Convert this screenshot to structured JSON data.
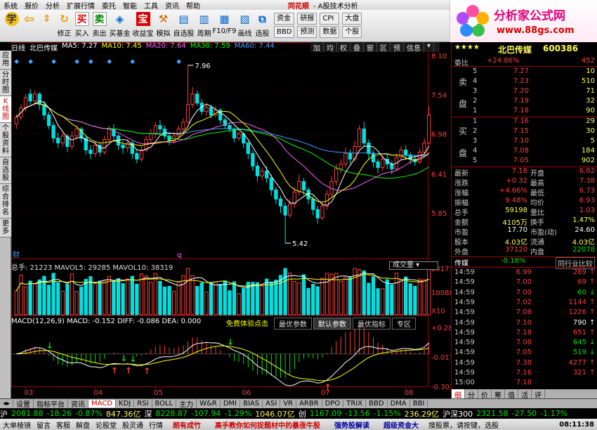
{
  "menu": {
    "items": [
      "系统",
      "报价",
      "分析",
      "扩展行情",
      "委托",
      "智能",
      "工具",
      "资讯",
      "帮助"
    ],
    "brand": "同花顺",
    "app_title": "- A股技术分析"
  },
  "logo": {
    "text1": "分析家公式网",
    "text2": "www.88gs.com"
  },
  "toolbar": {
    "buttons": [
      "",
      "",
      "修正",
      "买入",
      "卖出",
      "买基金",
      "收益宝",
      "模拟",
      "自选股",
      "周期",
      "F10/F9",
      "画线",
      "选股"
    ],
    "right_buttons": [
      "资金",
      "研报",
      "CPI",
      "大盘",
      "BBD",
      "预测",
      "数据",
      "个股"
    ]
  },
  "left_tabs": [
    "应用",
    "分时图",
    "K线图",
    "个股资料",
    "自选股",
    "综合排名",
    "更多"
  ],
  "kline": {
    "period": "日线",
    "name": "北巴传媒",
    "ma5": "MA5: 7.27",
    "ma10": "MA10: 7.45",
    "ma20": "MA20: 7.64",
    "ma30": "MA30: 7.59",
    "ma60": "MA60: 7.44",
    "buttons": [
      "加",
      "均",
      "权",
      "叠",
      "窗",
      "区",
      "预",
      "信息"
    ],
    "high_label": "7.96",
    "low_label": "5.42",
    "cai_label": "财",
    "q_label": "q",
    "price_ticks": [
      "8.10",
      "7.54",
      "6.98",
      "6.41",
      "5.85"
    ],
    "volume_info": "总手: 21223  MAVOL5: 29285  MAVOL10: 38319",
    "volume_select": "成交量",
    "volume_ticks": [
      "20177",
      "10088",
      "X10"
    ],
    "macd_info": "MACD(12,26,9)  MACD: -0.152  DIFF: -0.086  DEA: 0.000",
    "macd_btns": [
      "免费体验点击",
      "最优参数",
      "默认参数",
      "最优指标",
      "专区"
    ],
    "macd_ticks": [
      "+0.287",
      "-0.017",
      "-0.303"
    ],
    "date_ticks": [
      "03",
      "04",
      "05",
      "06",
      "07",
      "08"
    ]
  },
  "chart_data": {
    "type": "candlestick",
    "title": "北巴传媒 日线",
    "ylim": [
      5.3,
      8.15
    ],
    "x_months": [
      "03",
      "04",
      "05",
      "06",
      "07",
      "08"
    ],
    "candles": [
      [
        7.12,
        7.22,
        7.26,
        7.05
      ],
      [
        7.22,
        7.35,
        7.4,
        7.18
      ],
      [
        7.35,
        7.5,
        7.55,
        7.3
      ],
      [
        7.55,
        7.45,
        7.62,
        7.4
      ],
      [
        7.45,
        7.55,
        7.6,
        7.38
      ],
      [
        7.55,
        7.4,
        7.58,
        7.32
      ],
      [
        7.4,
        7.25,
        7.45,
        7.18
      ],
      [
        7.25,
        7.1,
        7.3,
        7.05
      ],
      [
        7.1,
        6.92,
        7.15,
        6.85
      ],
      [
        6.92,
        6.85,
        7.0,
        6.78
      ],
      [
        6.85,
        6.95,
        7.0,
        6.8
      ],
      [
        6.95,
        6.8,
        6.98,
        6.72
      ],
      [
        6.8,
        6.95,
        7.02,
        6.76
      ],
      [
        6.95,
        7.05,
        7.1,
        6.9
      ],
      [
        7.05,
        6.92,
        7.08,
        6.86
      ],
      [
        6.92,
        6.75,
        6.95,
        6.68
      ],
      [
        6.75,
        6.7,
        6.82,
        6.62
      ],
      [
        6.7,
        6.82,
        6.88,
        6.65
      ],
      [
        6.82,
        6.72,
        6.86,
        6.66
      ],
      [
        6.72,
        6.9,
        6.95,
        6.68
      ],
      [
        6.9,
        7.05,
        7.1,
        6.86
      ],
      [
        7.05,
        6.95,
        7.12,
        6.9
      ],
      [
        6.95,
        6.82,
        6.98,
        6.75
      ],
      [
        6.82,
        6.78,
        6.88,
        6.7
      ],
      [
        6.78,
        6.85,
        6.9,
        6.72
      ],
      [
        6.85,
        6.7,
        6.88,
        6.62
      ],
      [
        6.7,
        6.62,
        6.75,
        6.56
      ],
      [
        6.62,
        6.75,
        6.8,
        6.58
      ],
      [
        6.75,
        6.9,
        6.95,
        6.72
      ],
      [
        6.9,
        6.98,
        7.05,
        6.85
      ],
      [
        6.98,
        7.1,
        7.15,
        6.92
      ],
      [
        7.1,
        7.05,
        7.18,
        7.0
      ],
      [
        7.05,
        6.95,
        7.1,
        6.9
      ],
      [
        6.95,
        6.88,
        7.0,
        6.82
      ],
      [
        6.88,
        6.95,
        7.0,
        6.84
      ],
      [
        6.95,
        7.05,
        7.1,
        6.9
      ],
      [
        7.05,
        7.15,
        7.2,
        7.0
      ],
      [
        7.15,
        7.4,
        7.96,
        7.12
      ],
      [
        7.4,
        7.55,
        7.65,
        7.35
      ],
      [
        7.55,
        7.42,
        7.6,
        7.38
      ],
      [
        7.42,
        7.3,
        7.48,
        7.25
      ],
      [
        7.3,
        7.36,
        7.42,
        7.24
      ],
      [
        7.36,
        7.25,
        7.4,
        7.2
      ],
      [
        7.25,
        7.32,
        7.38,
        7.22
      ],
      [
        7.32,
        7.18,
        7.35,
        7.12
      ],
      [
        7.18,
        7.1,
        7.22,
        7.05
      ],
      [
        7.1,
        7.05,
        7.15,
        7.0
      ],
      [
        7.05,
        6.92,
        7.08,
        6.86
      ],
      [
        6.92,
        6.98,
        7.02,
        6.88
      ],
      [
        6.98,
        6.85,
        7.0,
        6.78
      ],
      [
        6.85,
        6.7,
        6.88,
        6.62
      ],
      [
        6.7,
        6.52,
        6.75,
        6.45
      ],
      [
        6.52,
        6.38,
        6.58,
        6.3
      ],
      [
        6.38,
        6.45,
        6.5,
        6.32
      ],
      [
        6.45,
        6.35,
        6.52,
        6.28
      ],
      [
        6.35,
        6.18,
        6.4,
        6.1
      ],
      [
        6.18,
        6.05,
        6.22,
        5.98
      ],
      [
        6.05,
        5.95,
        6.1,
        5.85
      ],
      [
        5.95,
        5.82,
        6.0,
        5.42
      ],
      [
        5.82,
        5.98,
        6.05,
        5.78
      ],
      [
        5.98,
        6.15,
        6.22,
        5.92
      ],
      [
        6.15,
        6.3,
        6.4,
        6.1
      ],
      [
        6.3,
        6.18,
        6.35,
        6.1
      ],
      [
        6.18,
        6.05,
        6.22,
        5.98
      ],
      [
        6.05,
        5.9,
        6.1,
        5.82
      ],
      [
        5.9,
        5.78,
        5.95,
        5.7
      ],
      [
        5.78,
        5.95,
        6.0,
        5.75
      ],
      [
        5.95,
        6.12,
        6.18,
        5.9
      ],
      [
        6.12,
        6.3,
        6.38,
        6.08
      ],
      [
        6.3,
        6.48,
        6.55,
        6.25
      ],
      [
        6.48,
        6.55,
        6.62,
        6.42
      ],
      [
        6.55,
        6.7,
        6.78,
        6.5
      ],
      [
        6.7,
        6.62,
        6.76,
        6.55
      ],
      [
        6.62,
        6.8,
        6.88,
        6.58
      ],
      [
        6.8,
        7.05,
        7.1,
        6.78
      ],
      [
        7.05,
        6.85,
        7.15,
        6.8
      ],
      [
        6.85,
        6.7,
        6.9,
        6.62
      ],
      [
        6.7,
        6.58,
        6.75,
        6.5
      ],
      [
        6.58,
        6.5,
        6.62,
        6.42
      ],
      [
        6.5,
        6.62,
        6.68,
        6.45
      ],
      [
        6.62,
        6.55,
        6.68,
        6.48
      ],
      [
        6.55,
        6.48,
        6.6,
        6.4
      ],
      [
        6.48,
        6.65,
        6.7,
        6.45
      ],
      [
        6.65,
        6.75,
        6.8,
        6.6
      ],
      [
        6.75,
        6.68,
        6.82,
        6.62
      ],
      [
        6.68,
        6.62,
        6.72,
        6.55
      ],
      [
        6.62,
        6.58,
        6.68,
        6.52
      ],
      [
        6.58,
        6.72,
        6.78,
        6.55
      ],
      [
        6.72,
        6.85,
        6.92,
        6.68
      ],
      [
        6.85,
        7.25,
        7.38,
        6.82
      ]
    ],
    "volume_max": 20177,
    "macd_range": [
      -0.303,
      0.287
    ]
  },
  "quote": {
    "stars": "★★★★",
    "name": "北巴传媒",
    "code": "600386",
    "weibi_label": "委比",
    "weibi_value": "+24.86%",
    "weibi_diff": "452",
    "sell_label": [
      "卖",
      "盘"
    ],
    "buy_label": [
      "买",
      "盘"
    ],
    "sells": [
      [
        "5",
        "7.27",
        "10"
      ],
      [
        "4",
        "7.23",
        "510"
      ],
      [
        "3",
        "7.20",
        "71"
      ],
      [
        "2",
        "7.19",
        "32"
      ],
      [
        "1",
        "7.18",
        "90"
      ]
    ],
    "buys": [
      [
        "1",
        "7.16",
        "29"
      ],
      [
        "2",
        "7.15",
        "30"
      ],
      [
        "3",
        "7.10",
        "5"
      ],
      [
        "4",
        "7.08",
        "184"
      ],
      [
        "5",
        "7.05",
        "902"
      ]
    ],
    "stats": [
      [
        "最新",
        "7.18",
        "开盘",
        "6.82"
      ],
      [
        "涨跌",
        "+0.32",
        "最高",
        "7.38"
      ],
      [
        "涨幅",
        "+4.66%",
        "最低",
        "6.73"
      ],
      [
        "振幅",
        "9.48%",
        "均价",
        "6.93"
      ],
      [
        "总手",
        "59198",
        "量比",
        "1.03"
      ],
      [
        "金额",
        "4105万",
        "换手",
        "1.47%"
      ],
      [
        "市盈",
        "17.70",
        "市盈(动)",
        "24.60"
      ],
      [
        "股本",
        "4.03亿",
        "流通",
        "4.03亿"
      ],
      [
        "外盘",
        "37120",
        "内盘",
        "22078"
      ]
    ],
    "sector_name": "传媒",
    "sector_pct": "-0.18%",
    "sector_btn": "同行业比较",
    "ticks": [
      [
        "14:59",
        "6.99",
        "289",
        "up"
      ],
      [
        "14:59",
        "7.00",
        "69",
        "up"
      ],
      [
        "14:59",
        "7.00",
        "60",
        "down"
      ],
      [
        "14:59",
        "7.02",
        "1144",
        "up"
      ],
      [
        "14:59",
        "7.08",
        "1226",
        "up"
      ],
      [
        "14:59",
        "7.10",
        "790",
        "up-w"
      ],
      [
        "14:59",
        "7.18",
        "651",
        "up"
      ],
      [
        "14:59",
        "7.08",
        "645",
        "down"
      ],
      [
        "14:59",
        "7.05",
        "519",
        "down"
      ],
      [
        "14:59",
        "7.38",
        "4277",
        "up"
      ],
      [
        "14:59",
        "7.16",
        "321",
        "up"
      ],
      [
        "15:00",
        "7.18",
        "",
        ""
      ]
    ],
    "detail_tabs": [
      "细",
      "分",
      "价",
      "筹",
      "值",
      "活",
      "评"
    ]
  },
  "bottom_tabs": [
    "设置",
    "指标平台",
    "资讯",
    "MACD",
    "KDJ",
    "RSI",
    "BOLL",
    "主力",
    "W&R",
    "DMI",
    "BIAS",
    "ASI",
    "VR",
    "ARBR",
    "DPO",
    "TRIX",
    "BBD",
    "DMA",
    "BBI"
  ],
  "index_bar": {
    "sh_name": "沪",
    "sh_val": "2081.88",
    "sh_chg": "-18.26",
    "sh_pct": "-0.87%",
    "sh_amt": "847.36亿",
    "sz_name": "深",
    "sz_val": "8228.87",
    "sz_chg": "-107.94",
    "sz_pct": "-1.29%",
    "sz_amt": "1046.07亿",
    "cy_name": "创",
    "cy_val": "1167.09",
    "cy_chg": "-13.56",
    "cy_pct": "-1.15%",
    "cy_amt": "236.29亿",
    "hs_name": "沪深300",
    "hs_val": "2321.58",
    "hs_chg": "-27.50",
    "hs_pct": "-1.17%"
  },
  "status": {
    "items": [
      "大单棱镜",
      "留言",
      "客服",
      "解盘",
      "论股堂",
      "股灵通",
      "行情"
    ],
    "news": [
      "朗有成竹",
      "高手教你如何捉题材中的暴涨牛股",
      "强势股解读",
      "超级资金大"
    ],
    "hint": "搜股票，请按键，选股",
    "clock": "08:11:38"
  },
  "colors": {
    "up": "#ff3c3c",
    "down": "#00e0e0",
    "ma5": "#ffffff",
    "ma10": "#ffff00",
    "ma20": "#ff60ff",
    "ma30": "#00ff00",
    "ma60": "#3fa0ff"
  }
}
